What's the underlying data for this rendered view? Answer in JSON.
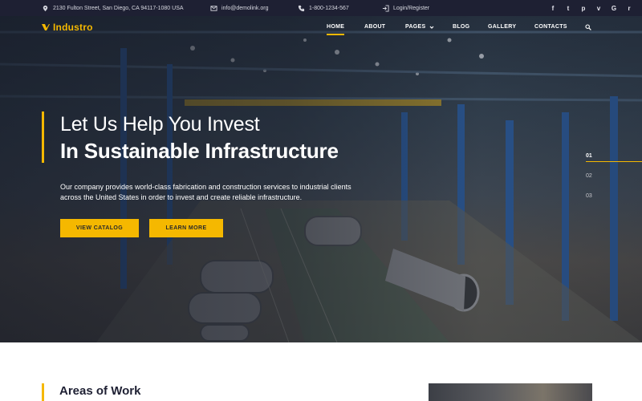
{
  "topbar": {
    "address": "2130 Fulton Street, San Diego, CA 94117-1080 USA",
    "email": "info@demolink.org",
    "phone": "1-800-1234-567",
    "login": "Login/Register",
    "social": [
      {
        "name": "facebook-icon",
        "glyph": "f"
      },
      {
        "name": "twitter-icon",
        "glyph": "t"
      },
      {
        "name": "pinterest-icon",
        "glyph": "p"
      },
      {
        "name": "vimeo-icon",
        "glyph": "v"
      },
      {
        "name": "google-icon",
        "glyph": "G"
      },
      {
        "name": "rss-icon",
        "glyph": "r"
      }
    ]
  },
  "brand": {
    "name": "Industro",
    "accent": "#f5b800",
    "dark": "#1e2033"
  },
  "nav": {
    "items": [
      "HOME",
      "ABOUT",
      "PAGES",
      "BLOG",
      "GALLERY",
      "CONTACTS"
    ],
    "active": "HOME"
  },
  "hero": {
    "title_light": "Let Us Help You Invest",
    "title_bold": "In Sustainable Infrastructure",
    "description": "Our company provides world-class fabrication and construction services to industrial clients across the United States in order to invest and create reliable infrastructure.",
    "button_catalog": "VIEW CATALOG",
    "button_learn": "LEARN MORE",
    "slides": [
      "01",
      "02",
      "03"
    ],
    "active_slide": "01"
  },
  "section": {
    "title": "Areas of Work"
  }
}
